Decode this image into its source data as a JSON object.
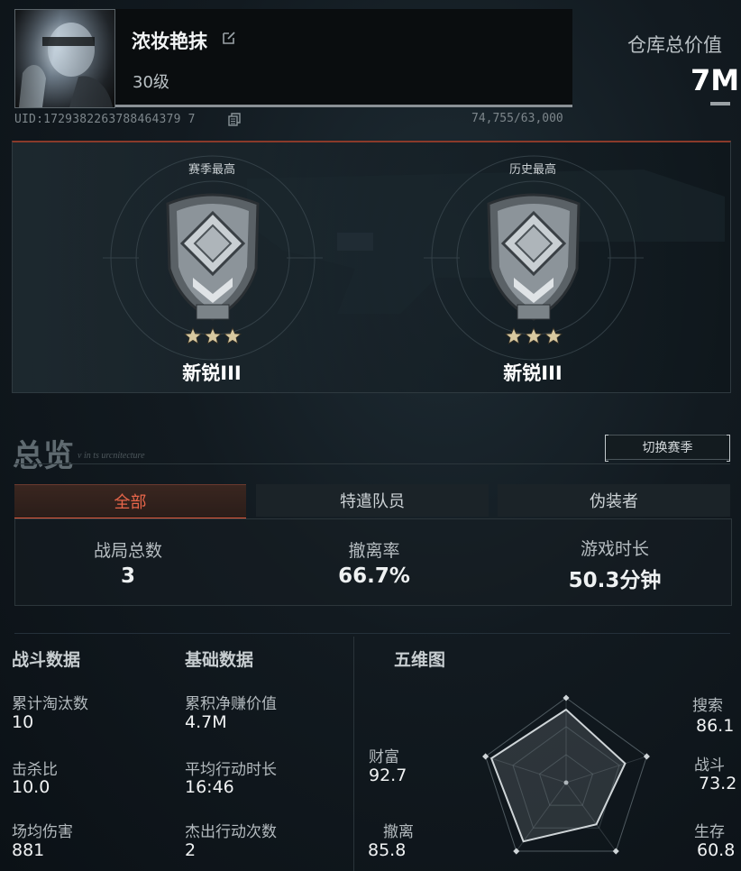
{
  "profile": {
    "name": "浓妆艳抹",
    "level": "30级",
    "uid": "UID:1729382263788464379 7",
    "xp": "74,755/63,000"
  },
  "warehouse": {
    "label": "仓库总价值",
    "value": "7M"
  },
  "ranks": {
    "season": {
      "label": "赛季最高",
      "rank": "新锐III",
      "stars": 3
    },
    "history": {
      "label": "历史最高",
      "rank": "新锐III",
      "stars": 3
    }
  },
  "overview": {
    "title": "总览",
    "subtitle": "v in ts urcnitecture",
    "switch_season": "切换赛季",
    "tabs": [
      {
        "label": "全部",
        "active": true
      },
      {
        "label": "特遣队员",
        "active": false
      },
      {
        "label": "伪装者",
        "active": false
      }
    ],
    "summary": [
      {
        "label": "战局总数",
        "value": "3"
      },
      {
        "label": "撤离率",
        "value": "66.7%"
      },
      {
        "label": "游戏时长",
        "value": "50.3分钟"
      }
    ]
  },
  "combat": {
    "title": "战斗数据",
    "items": [
      {
        "label": "累计淘汰数",
        "value": "10"
      },
      {
        "label": "击杀比",
        "value": "10.0"
      },
      {
        "label": "场均伤害",
        "value": "881"
      }
    ]
  },
  "basic": {
    "title": "基础数据",
    "items": [
      {
        "label": "累积净赚价值",
        "value": "4.7M"
      },
      {
        "label": "平均行动时长",
        "value": "16:46"
      },
      {
        "label": "杰出行动次数",
        "value": "2"
      }
    ]
  },
  "radar": {
    "title": "五维图",
    "axes": [
      {
        "label": "搜索",
        "value": "86.1",
        "score": 86.1
      },
      {
        "label": "战斗",
        "value": "73.2",
        "score": 73.2
      },
      {
        "label": "生存",
        "value": "60.8",
        "score": 60.8
      },
      {
        "label": "撤离",
        "value": "85.8",
        "score": 85.8
      },
      {
        "label": "财富",
        "value": "92.7",
        "score": 92.7
      }
    ]
  },
  "colors": {
    "accent": "#e05a3e",
    "text": "#f0f2f3",
    "muted": "#b3babe"
  },
  "icons": {
    "edit": "edit-icon",
    "copy": "copy-icon"
  }
}
